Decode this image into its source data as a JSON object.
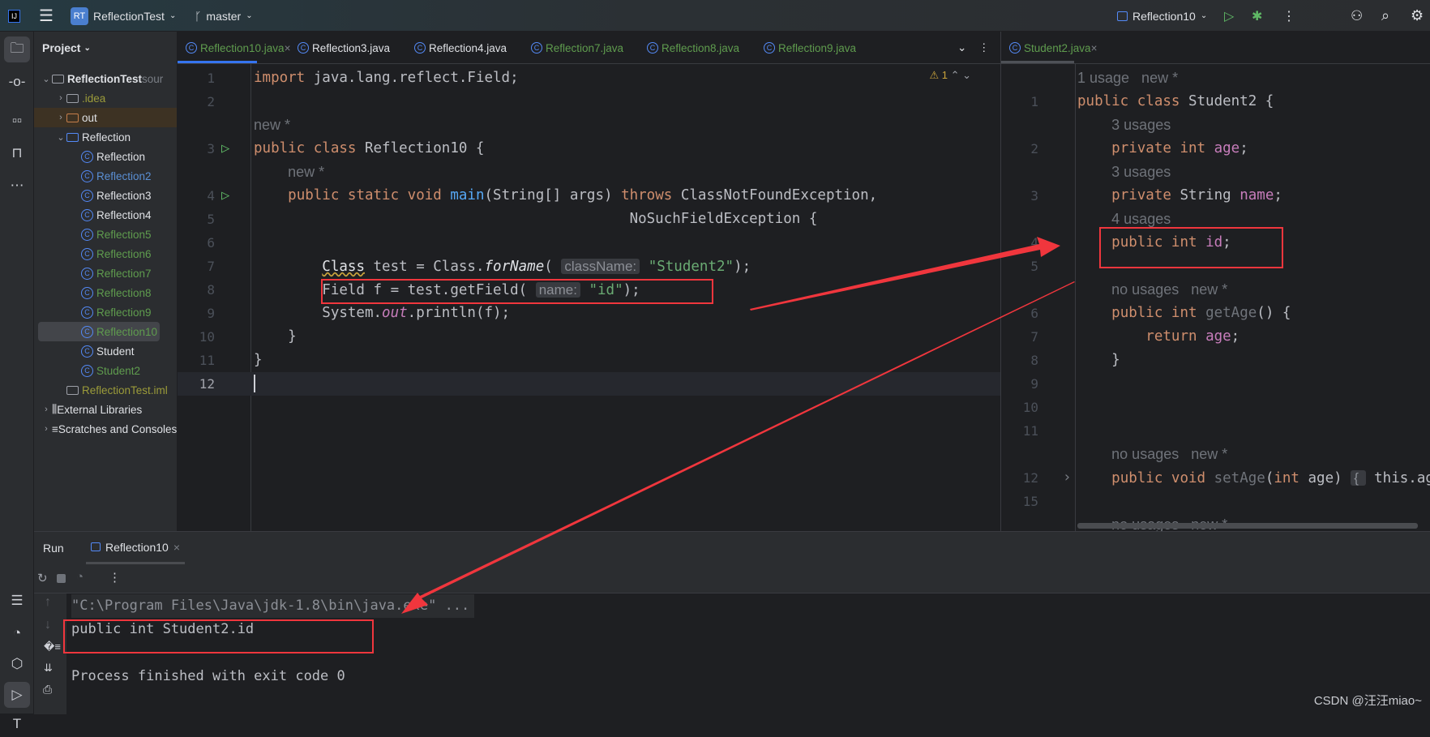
{
  "topbar": {
    "project_initials": "RT",
    "project": "ReflectionTest",
    "branch": "master",
    "run_config": "Reflection10"
  },
  "project_panel": {
    "title": "Project",
    "tree": [
      {
        "label": "ReflectionTest",
        "suffix": "sour",
        "level": 0,
        "type": "module",
        "open": true,
        "color": "w"
      },
      {
        "label": ".idea",
        "level": 1,
        "type": "folder",
        "open": false,
        "color": "y"
      },
      {
        "label": "out",
        "level": 1,
        "type": "folder-out",
        "open": false,
        "color": "w"
      },
      {
        "label": "Reflection",
        "level": 1,
        "type": "folder-src",
        "open": true,
        "color": "w"
      },
      {
        "label": "Reflection",
        "level": 2,
        "type": "class",
        "color": "w"
      },
      {
        "label": "Reflection2",
        "level": 2,
        "type": "class",
        "color": "b"
      },
      {
        "label": "Reflection3",
        "level": 2,
        "type": "class",
        "color": "w"
      },
      {
        "label": "Reflection4",
        "level": 2,
        "type": "class",
        "color": "w"
      },
      {
        "label": "Reflection5",
        "level": 2,
        "type": "class",
        "color": "g"
      },
      {
        "label": "Reflection6",
        "level": 2,
        "type": "class",
        "color": "g"
      },
      {
        "label": "Reflection7",
        "level": 2,
        "type": "class",
        "color": "g"
      },
      {
        "label": "Reflection8",
        "level": 2,
        "type": "class",
        "color": "g"
      },
      {
        "label": "Reflection9",
        "level": 2,
        "type": "class",
        "color": "g"
      },
      {
        "label": "Reflection10",
        "level": 2,
        "type": "class",
        "color": "g",
        "selected": true
      },
      {
        "label": "Student",
        "level": 2,
        "type": "class",
        "color": "w"
      },
      {
        "label": "Student2",
        "level": 2,
        "type": "class",
        "color": "g"
      },
      {
        "label": "ReflectionTest.iml",
        "level": 1,
        "type": "file",
        "color": "y"
      },
      {
        "label": "External Libraries",
        "level": 0,
        "type": "lib",
        "open": false,
        "color": "w"
      },
      {
        "label": "Scratches and Consoles",
        "level": 0,
        "type": "scratch",
        "open": false,
        "color": "w"
      }
    ]
  },
  "editor_tabs": [
    {
      "label": "Reflection10.java",
      "color": "g",
      "active": true,
      "closable": true
    },
    {
      "label": "Reflection3.java",
      "color": "w"
    },
    {
      "label": "Reflection4.java",
      "color": "w"
    },
    {
      "label": "Reflection7.java",
      "color": "g"
    },
    {
      "label": "Reflection8.java",
      "color": "g"
    },
    {
      "label": "Reflection9.java",
      "color": "g"
    }
  ],
  "right_tabs": [
    {
      "label": "Student2.java",
      "color": "g",
      "active": true,
      "closable": true
    }
  ],
  "warnings": {
    "count": "1"
  },
  "left_code": [
    {
      "ln": "1",
      "t": [
        [
          "kw",
          "import "
        ],
        [
          "tx",
          "java.lang.reflect.Field;"
        ]
      ]
    },
    {
      "ln": "2",
      "t": []
    },
    {
      "ln": "",
      "t": [
        [
          "hint",
          "new *"
        ]
      ]
    },
    {
      "ln": "3",
      "run": true,
      "t": [
        [
          "kw",
          "public class "
        ],
        [
          "tx",
          "Reflection10 {"
        ]
      ]
    },
    {
      "ln": "",
      "t": [
        [
          "tx",
          "    "
        ],
        [
          "hint",
          "new *"
        ]
      ]
    },
    {
      "ln": "4",
      "run": true,
      "t": [
        [
          "tx",
          "    "
        ],
        [
          "kw",
          "public static void "
        ],
        [
          "mt",
          "main"
        ],
        [
          "tx",
          "(String[] args) "
        ],
        [
          "kw",
          "throws "
        ],
        [
          "tx",
          "ClassNotFoundException,"
        ]
      ]
    },
    {
      "ln": "5",
      "t": [
        [
          "tx",
          "                                            NoSuchFieldException {"
        ]
      ]
    },
    {
      "ln": "6",
      "t": []
    },
    {
      "ln": "7",
      "t": [
        [
          "tx",
          "        "
        ],
        [
          "wav",
          "Class"
        ],
        [
          "tx",
          " test = Class."
        ],
        [
          "it",
          "forName"
        ],
        [
          "tx",
          "( "
        ],
        [
          "inl",
          "className:"
        ],
        [
          "st",
          " \"Student2\""
        ],
        [
          "tx",
          ");"
        ]
      ]
    },
    {
      "ln": "8",
      "t": [
        [
          "tx",
          "        Field f = test.getField( "
        ],
        [
          "inl",
          "name:"
        ],
        [
          "st",
          " \"id\""
        ],
        [
          "tx",
          ");"
        ]
      ]
    },
    {
      "ln": "9",
      "t": [
        [
          "tx",
          "        System."
        ],
        [
          "fdit",
          "out"
        ],
        [
          "tx",
          ".println(f);"
        ]
      ]
    },
    {
      "ln": "10",
      "t": [
        [
          "tx",
          "    }"
        ]
      ]
    },
    {
      "ln": "11",
      "t": [
        [
          "tx",
          "}"
        ]
      ]
    },
    {
      "ln": "12",
      "current": true,
      "t": []
    }
  ],
  "right_code": [
    {
      "ln": "",
      "t": [
        [
          "hint",
          "1 usage   new *"
        ]
      ]
    },
    {
      "ln": "1",
      "t": [
        [
          "kw",
          "public class "
        ],
        [
          "tx",
          "Student2 {"
        ]
      ]
    },
    {
      "ln": "",
      "t": [
        [
          "tx",
          "    "
        ],
        [
          "hint",
          "3 usages"
        ]
      ]
    },
    {
      "ln": "2",
      "t": [
        [
          "tx",
          "    "
        ],
        [
          "kw",
          "private int "
        ],
        [
          "fd",
          "age"
        ],
        [
          "tx",
          ";"
        ]
      ]
    },
    {
      "ln": "",
      "t": [
        [
          "tx",
          "    "
        ],
        [
          "hint",
          "3 usages"
        ]
      ]
    },
    {
      "ln": "3",
      "t": [
        [
          "tx",
          "    "
        ],
        [
          "kw",
          "private "
        ],
        [
          "tx",
          "String "
        ],
        [
          "fd",
          "name"
        ],
        [
          "tx",
          ";"
        ]
      ]
    },
    {
      "ln": "",
      "t": [
        [
          "tx",
          "    "
        ],
        [
          "hint",
          "4 usages"
        ]
      ]
    },
    {
      "ln": "4",
      "t": [
        [
          "tx",
          "    "
        ],
        [
          "kw",
          "public int "
        ],
        [
          "fd",
          "id"
        ],
        [
          "tx",
          ";"
        ]
      ]
    },
    {
      "ln": "5",
      "t": []
    },
    {
      "ln": "",
      "t": [
        [
          "tx",
          "    "
        ],
        [
          "hint",
          "no usages   new *"
        ]
      ]
    },
    {
      "ln": "6",
      "t": [
        [
          "tx",
          "    "
        ],
        [
          "kw",
          "public int "
        ],
        [
          "gr",
          "getAge"
        ],
        [
          "tx",
          "() {"
        ]
      ]
    },
    {
      "ln": "7",
      "t": [
        [
          "tx",
          "        "
        ],
        [
          "kw",
          "return "
        ],
        [
          "fd",
          "age"
        ],
        [
          "tx",
          ";"
        ]
      ]
    },
    {
      "ln": "8",
      "t": [
        [
          "tx",
          "    }"
        ]
      ]
    },
    {
      "ln": "9",
      "t": []
    },
    {
      "ln": "10",
      "t": []
    },
    {
      "ln": "11",
      "t": []
    },
    {
      "ln": "",
      "t": [
        [
          "tx",
          "    "
        ],
        [
          "hint",
          "no usages   new *"
        ]
      ]
    },
    {
      "ln": "12",
      "fold": true,
      "t": [
        [
          "tx",
          "    "
        ],
        [
          "kw",
          "public void "
        ],
        [
          "gr",
          "setAge"
        ],
        [
          "tx",
          "("
        ],
        [
          "kw",
          "int "
        ],
        [
          "tx",
          "age) "
        ],
        [
          "inl",
          "{ "
        ],
        [
          "tx",
          " this.age = age; }"
        ]
      ]
    },
    {
      "ln": "15",
      "t": []
    },
    {
      "ln": "",
      "t": [
        [
          "tx",
          "    "
        ],
        [
          "hint",
          "no usages   new *"
        ]
      ]
    }
  ],
  "run_panel": {
    "title": "Run",
    "tab": "Reflection10",
    "console": [
      "\"C:\\Program Files\\Java\\jdk-1.8\\bin\\java.exe\" ...",
      "public int Student2.id",
      "",
      "Process finished with exit code 0"
    ]
  },
  "watermark": "CSDN @汪汪miao~",
  "colors": {
    "accent": "#3574f0",
    "annotation": "#f0363d",
    "keyword": "#cf8e6d",
    "field": "#c77dbb",
    "string": "#6aab73",
    "method": "#56a8f5"
  }
}
